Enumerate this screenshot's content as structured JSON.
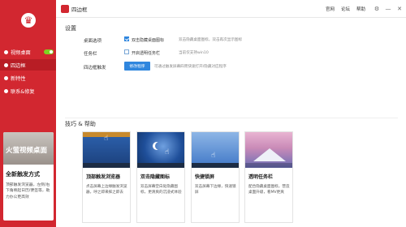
{
  "app": {
    "title": "四边框"
  },
  "sidebar": {
    "logo_glyph": "♛",
    "items": [
      {
        "label": "视频桌面",
        "toggle": true
      },
      {
        "label": "四边框"
      },
      {
        "label": "新特性"
      },
      {
        "label": "联系&修复"
      }
    ],
    "promo": {
      "image_text": "火萤视频桌面",
      "title": "全新触发方式",
      "desc": "顶部触发浏览器，左侧/右下角唤起日历/便签等，助力办公更高效"
    }
  },
  "top_links": [
    "官网",
    "论坛",
    "帮助"
  ],
  "window_controls": {
    "settings": "⚙",
    "minimize": "—",
    "close": "✕"
  },
  "settings": {
    "title": "设置",
    "rows": [
      {
        "label": "桌面选项",
        "options": [
          {
            "label": "双击隐藏桌面图标",
            "checked": true
          }
        ],
        "hint": "双击隐藏桌面图标，双击再次显示图标"
      },
      {
        "label": "任务栏",
        "options": [
          {
            "label": "开启透明任务栏",
            "checked": false
          }
        ],
        "hint": "当前仅支持win10"
      },
      {
        "label": "四边框触发",
        "button": "修改程序",
        "hint": "可通过触发屏幕四周快速打开/隐藏对应程序"
      }
    ]
  },
  "tips": {
    "title": "技巧 & 帮助",
    "cards": [
      {
        "title": "顶部触发浏览器",
        "desc": "点击屏幕上边缘触发浏览器，呼之即来挥之即去"
      },
      {
        "title": "双击隐藏图标",
        "desc": "双击屏幕空白处隐藏图标，更清爽的沉浸式体验"
      },
      {
        "title": "快捷锁屏",
        "desc": "双击屏幕下边缘，快速锁屏"
      },
      {
        "title": "透明任务栏",
        "desc": "配合隐藏桌面图标，营造桌面升级，看MV更爽"
      }
    ]
  },
  "colors": {
    "brand": "#d22730",
    "accent": "#2f86de",
    "toggle_on": "#7ed321"
  }
}
